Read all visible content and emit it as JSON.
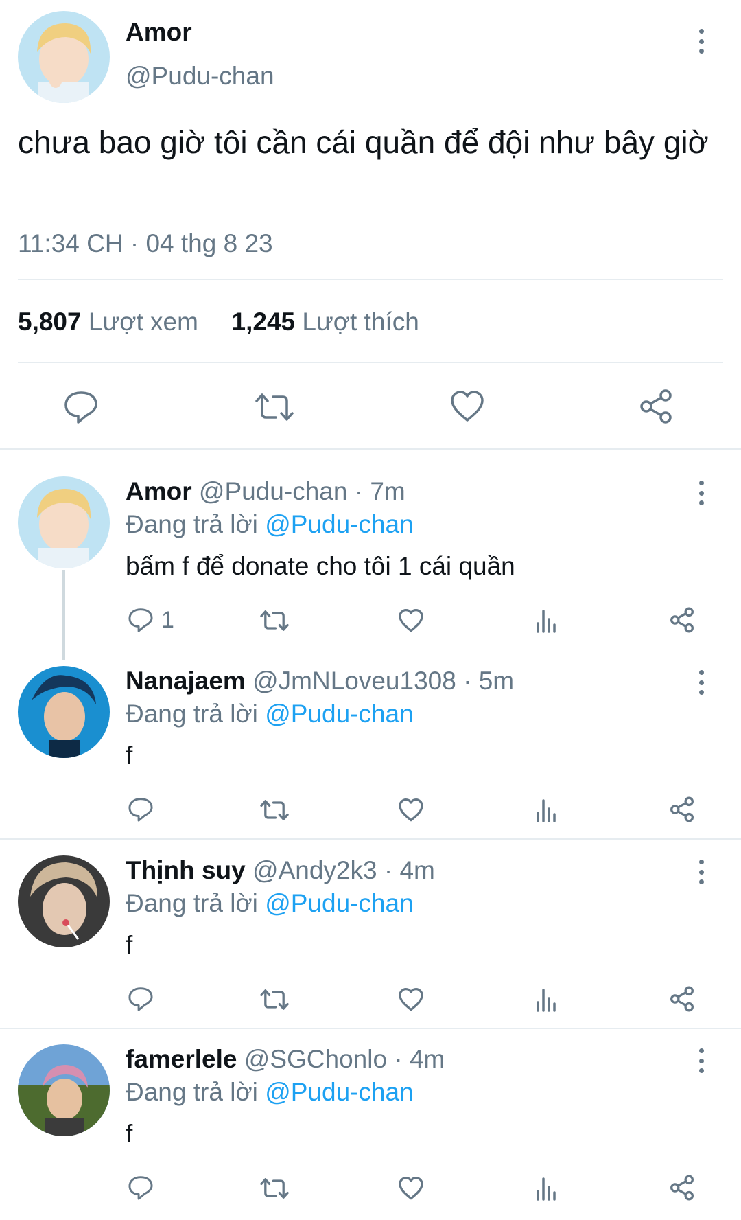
{
  "main_tweet": {
    "author_name": "Amor",
    "author_handle": "@Pudu-chan",
    "text": "chưa bao giờ tôi cần cái quần để đội như bây giờ",
    "timestamp": "11:34 CH · 04 thg 8 23",
    "views_count": "5,807",
    "views_label": "Lượt xem",
    "likes_count": "1,245",
    "likes_label": "Lượt thích",
    "actions": [
      "reply-icon",
      "retweet-icon",
      "like-icon",
      "share-icon"
    ]
  },
  "replying_to_label": "Đang trả lời",
  "replies": [
    {
      "name": "Amor",
      "handle": "@Pudu-chan",
      "time": "· 7m",
      "replying_to": "@Pudu-chan",
      "text": "bấm f để donate cho tôi 1 cái quần",
      "reply_count": "1"
    },
    {
      "name": "Nanajaem",
      "handle": "@JmNLoveu1308",
      "time": "· 5m",
      "replying_to": "@Pudu-chan",
      "text": "f",
      "reply_count": ""
    },
    {
      "name": "Thịnh suy",
      "handle": "@Andy2k3",
      "time": "· 4m",
      "replying_to": "@Pudu-chan",
      "text": "f",
      "reply_count": ""
    },
    {
      "name": "famerlele",
      "handle": "@SGChonlo",
      "time": "· 4m",
      "replying_to": "@Pudu-chan",
      "text": "f",
      "reply_count": ""
    }
  ],
  "colors": {
    "link": "#1da1f2",
    "muted": "#657786",
    "divider": "#e6ecf0"
  }
}
